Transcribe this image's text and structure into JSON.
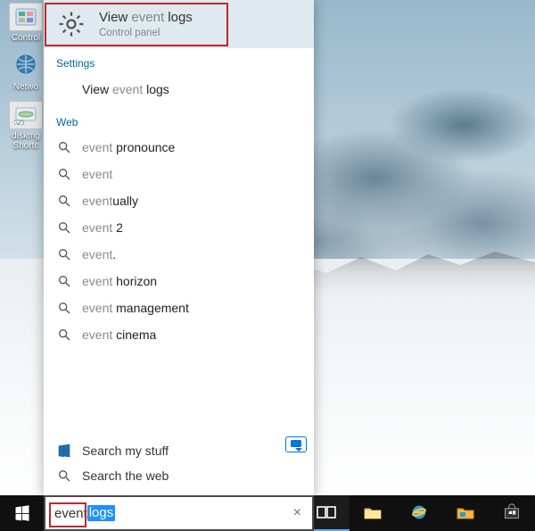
{
  "desktop": {
    "icons": [
      {
        "name": "control-panel",
        "label": "Control"
      },
      {
        "name": "network",
        "label": "Netwo"
      },
      {
        "name": "diskmgmt",
        "label": "diskmg\nShortc"
      }
    ]
  },
  "search": {
    "query_typed": "event",
    "query_selected": " logs",
    "best_match": {
      "title_prefix": "View ",
      "title_match": "event",
      "title_suffix": " logs",
      "subtitle": "Control panel"
    },
    "sections": {
      "settings": {
        "label": "Settings",
        "items": [
          {
            "prefix": "View ",
            "match": "event",
            "suffix": " logs",
            "icon": "gear"
          }
        ]
      },
      "web": {
        "label": "Web",
        "items": [
          {
            "prefix": "",
            "match": "event",
            "suffix": "   pronounce",
            "icon": "search"
          },
          {
            "prefix": "",
            "match": "event",
            "suffix": "",
            "icon": "search"
          },
          {
            "prefix": "",
            "match": "event",
            "suffix": "ually",
            "icon": "search"
          },
          {
            "prefix": "",
            "match": "event",
            "suffix": " 2",
            "icon": "search"
          },
          {
            "prefix": "",
            "match": "event",
            "suffix": ".",
            "icon": "search"
          },
          {
            "prefix": "",
            "match": "event",
            "suffix": " horizon",
            "icon": "search"
          },
          {
            "prefix": "",
            "match": "event",
            "suffix": " management",
            "icon": "search"
          },
          {
            "prefix": "",
            "match": "event",
            "suffix": " cinema",
            "icon": "search"
          }
        ]
      }
    },
    "bottom": {
      "my_stuff": "Search my stuff",
      "web": "Search the web"
    },
    "clear_glyph": "×"
  },
  "taskbar": {
    "items": [
      {
        "name": "task-view",
        "icon": "taskview"
      },
      {
        "name": "file-explorer",
        "icon": "explorer"
      },
      {
        "name": "internet-explorer",
        "icon": "ie"
      },
      {
        "name": "app-pinned-1",
        "icon": "folder-yellow"
      },
      {
        "name": "store",
        "icon": "store"
      }
    ]
  }
}
